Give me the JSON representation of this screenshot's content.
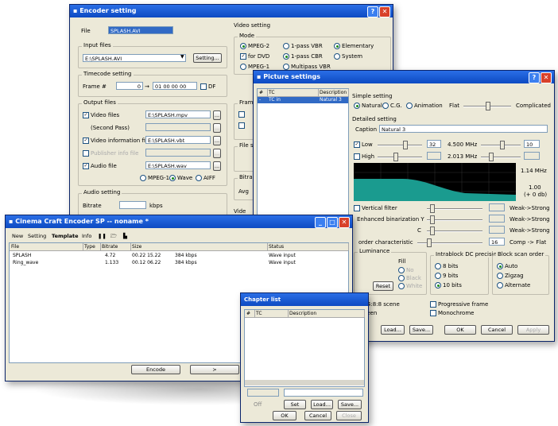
{
  "encoder": {
    "title": "Encoder setting",
    "file_label": "File",
    "file_value": "SPLASH.AVI",
    "input_files_label": "Input files",
    "input_file_value": "E:\\SPLASH.AVI",
    "setting_button": "Setting...",
    "timecode_label": "Timecode setting",
    "frame_label": "Frame #",
    "frame_value": "0",
    "timecode_value": "01 00 00 00",
    "df_label": "DF",
    "output_files_label": "Output files",
    "video_files_label": "Video files",
    "video_files_value": "E:\\SPLASH.mpv",
    "second_pass_label": "(Second Pass)",
    "video_info_label": "Video information file",
    "video_info_value": "E:\\SPLASH.vbt",
    "publisher_label": "Publisher info file",
    "audio_file_label": "Audio file",
    "audio_file_value": "E:\\SPLASH.wav",
    "audio_format_options": [
      "MPEG-1",
      "Wave",
      "AIFF"
    ],
    "audio_setting_label": "Audio setting",
    "bitrate_label": "Bitrate",
    "kbps_label": "kbps",
    "video_setting_label": "Video setting",
    "mode_label": "Mode",
    "mode_options": [
      "MPEG-2",
      "1-pass VBR",
      "Elementary",
      "for DVD",
      "1-pass CBR",
      "System",
      "MPEG-1",
      "Multipass VBR"
    ],
    "frame_group_label": "Fram",
    "file_group_label": "File s",
    "bitrate_group_label": "Bitra",
    "avg_label": "Avg",
    "video_group_label": "Vide"
  },
  "picture": {
    "title": "Picture settings",
    "list_headers": [
      "#",
      "TC",
      "Description"
    ],
    "list_row": [
      "-",
      "TC in",
      "Natural 3"
    ],
    "simple_setting_label": "Simple setting",
    "simple_options": [
      "Natural",
      "C.G.",
      "Animation"
    ],
    "flat_label": "Flat",
    "complicated_label": "Complicated",
    "detailed_setting_label": "Detailed setting",
    "caption_label": "Caption",
    "caption_value": "Natural 3",
    "low_label": "Low",
    "low_value": "32",
    "low_freq": "4.500 MHz",
    "low_right_value": "10",
    "high_label": "High",
    "high_freq": "2.013 MHz",
    "graph_top_label": "1.14 MHz",
    "graph_val_label": "1.00",
    "graph_db_label": "(+ 0 db)",
    "vertical_filter_label": "Vertical filter",
    "weak_strong": "Weak->Strong",
    "enhanced_label": "Enhanced binarization Y",
    "c_label": "C",
    "order_label": "order characteristic",
    "comp_value": "16",
    "comp_flat_label": "Comp -> Flat",
    "intrablock_label": "Intrablock DC precision",
    "bits_options": [
      "8 bits",
      "9 bits",
      "10 bits"
    ],
    "block_scan_label": "Block scan order",
    "scan_options": [
      "Auto",
      "Zigzag",
      "Alternate"
    ],
    "luminance_label": "Luminance",
    "fill_label": "Fill",
    "fill_options": [
      "No",
      "Black",
      "White"
    ],
    "reset_label": "Reset",
    "scene_label": "on 4:8:8 scene",
    "screen_label": "screen",
    "progressive_label": "Progressive frame",
    "monochrome_label": "Monochrome",
    "load_button": "Load...",
    "save_button": "Save...",
    "ok_button": "OK",
    "cancel_button": "Cancel",
    "apply_button": "Apply"
  },
  "main": {
    "title": "Cinema Craft Encoder SP -- noname *",
    "toolbar_items": [
      "New",
      "Setting",
      "Template",
      "Info"
    ],
    "columns": [
      "File",
      "Type",
      "Bitrate",
      "Size",
      "Status"
    ],
    "rows": [
      [
        "SPLASH",
        "",
        "4.72",
        "00.22 15.22",
        "384 kbps",
        "Wave input"
      ],
      [
        "Ring_wave",
        "",
        "1.133",
        "00.12 06.22",
        "384 kbps",
        "Wave input"
      ]
    ],
    "encode_button": "Encode",
    "extra_button": ">"
  },
  "chapter": {
    "title": "Chapter list",
    "headers": [
      "#",
      "TC",
      "Description"
    ],
    "off_label": "Off",
    "set_button": "Set",
    "load_button": "Load...",
    "save_button": "Save...",
    "ok_button": "OK",
    "cancel_button": "Cancel",
    "close_button": "Close"
  },
  "colors": {
    "titlebar": "#0d4ac2",
    "dialog_bg": "#ece9d8",
    "selection": "#316ac5",
    "graph_fill": "#1a9b8f"
  }
}
